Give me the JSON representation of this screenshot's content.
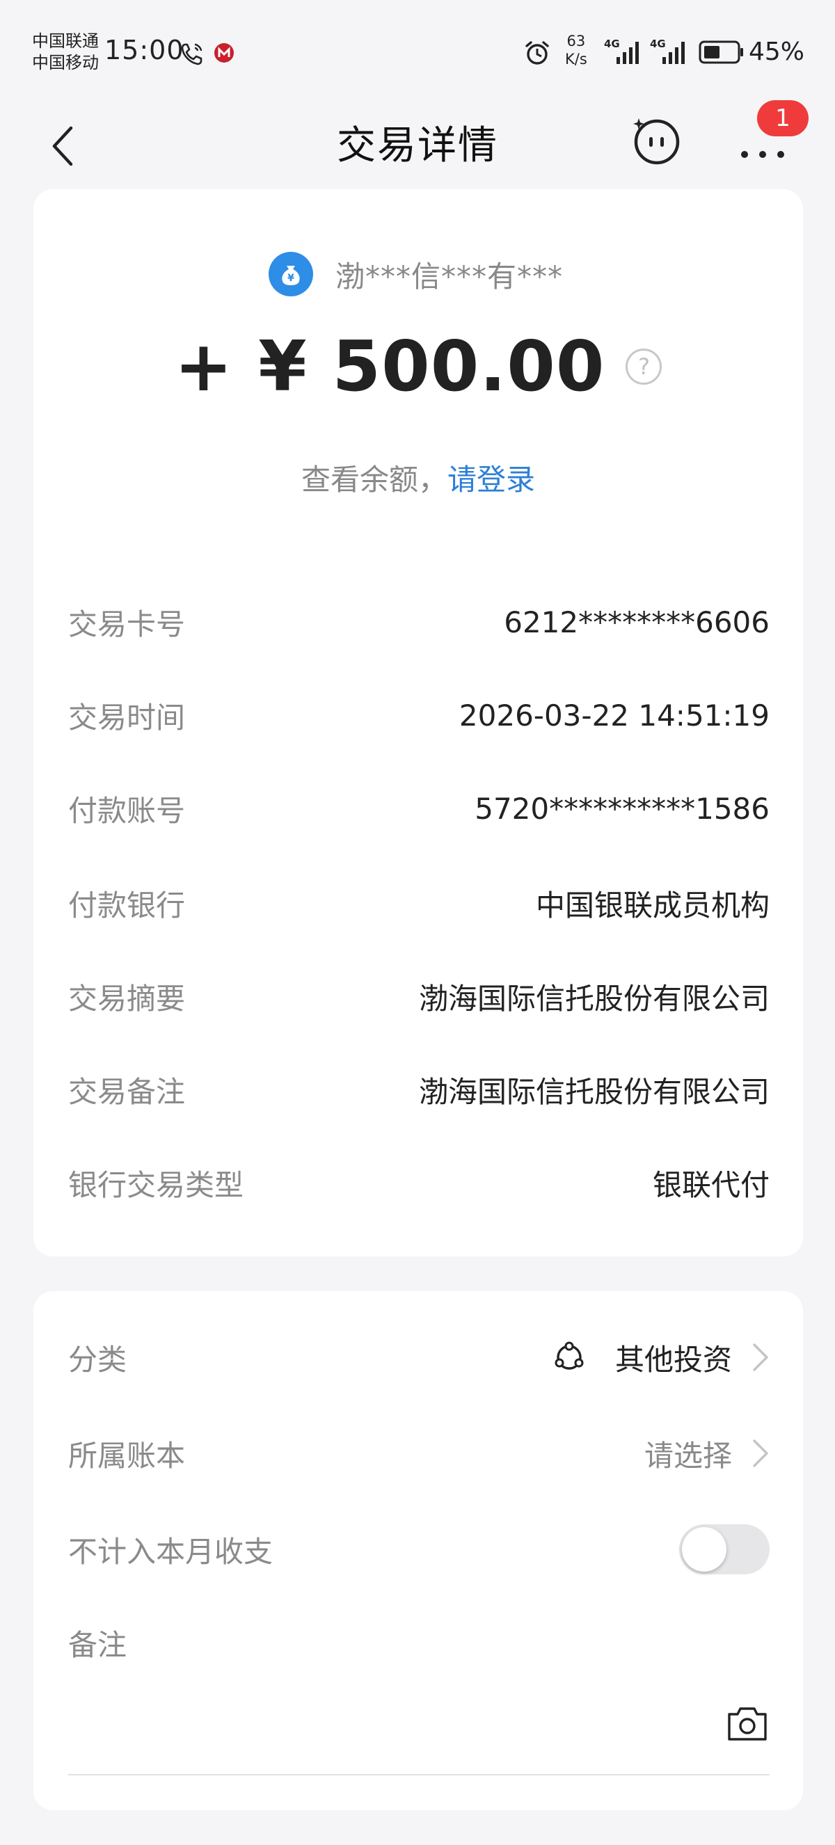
{
  "status_bar": {
    "carrier1": "中国联通",
    "carrier2": "中国移动",
    "time": "15:00",
    "speed_value": "63",
    "speed_unit": "K/s",
    "network1": "4G",
    "network2": "4G",
    "battery": "45%"
  },
  "header": {
    "title": "交易详情",
    "badge_count": "1"
  },
  "transaction": {
    "payee": "渤***信***有***",
    "amount": "+ ¥ 500.00",
    "balance_prompt": "查看余额，",
    "login_link": "请登录"
  },
  "details": [
    {
      "label": "交易卡号",
      "value": "6212********6606"
    },
    {
      "label": "交易时间",
      "value": "2026-03-22 14:51:19"
    },
    {
      "label": "付款账号",
      "value": "5720**********1586"
    },
    {
      "label": "付款银行",
      "value": "中国银联成员机构"
    },
    {
      "label": "交易摘要",
      "value": "渤海国际信托股份有限公司"
    },
    {
      "label": "交易备注",
      "value": "渤海国际信托股份有限公司"
    },
    {
      "label": "银行交易类型",
      "value": "银联代付"
    }
  ],
  "options": {
    "category_label": "分类",
    "category_value": "其他投资",
    "ledger_label": "所属账本",
    "ledger_value": "请选择",
    "exclude_label": "不计入本月收支",
    "exclude_enabled": false,
    "note_label": "备注"
  },
  "colors": {
    "accent": "#2e7fd6",
    "badge": "#ef3b3b",
    "background": "#f5f5f7"
  }
}
